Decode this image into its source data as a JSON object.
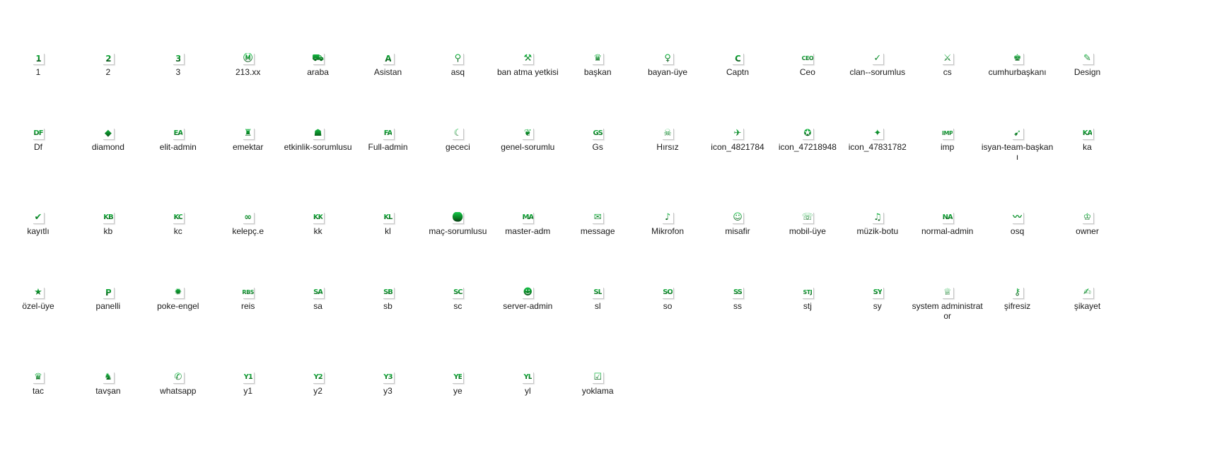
{
  "folder": {
    "items": [
      {
        "label": "1",
        "icon": "digit-one-icon",
        "glyph": "1"
      },
      {
        "label": "2",
        "icon": "digit-two-icon",
        "glyph": "2"
      },
      {
        "label": "3",
        "icon": "digit-three-icon",
        "glyph": "3"
      },
      {
        "label": "213.xx",
        "icon": "monogram-emblem-icon",
        "glyph": "Ⓜ"
      },
      {
        "label": "araba",
        "icon": "car-icon",
        "glyph": "⛟"
      },
      {
        "label": "Asistan",
        "icon": "letter-a-icon",
        "glyph": "A"
      },
      {
        "label": "asq",
        "icon": "user-search-icon",
        "glyph": "⚲"
      },
      {
        "label": "ban atma yetkisi",
        "icon": "ban-hammer-icon",
        "glyph": "⚒"
      },
      {
        "label": "başkan",
        "icon": "crown-icon",
        "glyph": "♛"
      },
      {
        "label": "bayan-üye",
        "icon": "female-user-icon",
        "glyph": "♀"
      },
      {
        "label": "Captn",
        "icon": "letter-c-icon",
        "glyph": "C"
      },
      {
        "label": "Ceo",
        "icon": "ceo-text-icon",
        "glyph": "CEO"
      },
      {
        "label": "clan--sorumlus",
        "icon": "shield-check-icon",
        "glyph": "✓"
      },
      {
        "label": "cs",
        "icon": "running-figure-icon",
        "glyph": "⚔"
      },
      {
        "label": "cumhurbaşkanı",
        "icon": "leader-bust-icon",
        "glyph": "♚"
      },
      {
        "label": "Design",
        "icon": "design-brush-icon",
        "glyph": "✎"
      },
      {
        "label": "Df",
        "icon": "df-text-icon",
        "glyph": "DF"
      },
      {
        "label": "diamond",
        "icon": "diamond-icon",
        "glyph": "◆"
      },
      {
        "label": "elit-admin",
        "icon": "ea-text-icon",
        "glyph": "EA"
      },
      {
        "label": "emektar",
        "icon": "veteran-figure-icon",
        "glyph": "♜"
      },
      {
        "label": "etkinlik-sorumlusu",
        "icon": "event-figure-icon",
        "glyph": "☗"
      },
      {
        "label": "Full-admin",
        "icon": "fa-text-icon",
        "glyph": "FA"
      },
      {
        "label": "gececi",
        "icon": "crescent-moon-icon",
        "glyph": "☾"
      },
      {
        "label": "genel-sorumlu",
        "icon": "winged-emblem-icon",
        "glyph": "❦"
      },
      {
        "label": "Gs",
        "icon": "gs-text-icon",
        "glyph": "GS"
      },
      {
        "label": "Hırsız",
        "icon": "thief-figure-icon",
        "glyph": "☠"
      },
      {
        "label": "icon_4821784",
        "icon": "bird-icon",
        "glyph": "✈"
      },
      {
        "label": "icon_47218948",
        "icon": "insignia-icon",
        "glyph": "✪"
      },
      {
        "label": "icon_47831782",
        "icon": "eagle-icon",
        "glyph": "✦"
      },
      {
        "label": "imp",
        "icon": "imp-text-icon",
        "glyph": "IMP"
      },
      {
        "label": "isyan-team-başkanı",
        "icon": "rifle-figure-icon",
        "glyph": "➹"
      },
      {
        "label": "ka",
        "icon": "ka-text-icon",
        "glyph": "KA"
      },
      {
        "label": "kayıtlı",
        "icon": "check-mark-icon",
        "glyph": "✔"
      },
      {
        "label": "kb",
        "icon": "kb-text-icon",
        "glyph": "KB"
      },
      {
        "label": "kc",
        "icon": "kc-text-icon",
        "glyph": "KC"
      },
      {
        "label": "kelepç.e",
        "icon": "handcuffs-icon",
        "glyph": "∞"
      },
      {
        "label": "kk",
        "icon": "kk-text-icon",
        "glyph": "KK"
      },
      {
        "label": "kl",
        "icon": "kl-text-icon",
        "glyph": "KL"
      },
      {
        "label": "maç-sorumlusu",
        "icon": "football-icon",
        "glyph": "⚽"
      },
      {
        "label": "master-adm",
        "icon": "ma-text-icon",
        "glyph": "MA"
      },
      {
        "label": "message",
        "icon": "message-envelope-icon",
        "glyph": "✉"
      },
      {
        "label": "Mikrofon",
        "icon": "microphone-icon",
        "glyph": "♪"
      },
      {
        "label": "misafir",
        "icon": "guest-user-icon",
        "glyph": "☺"
      },
      {
        "label": "mobil-üye",
        "icon": "mobile-phone-icon",
        "glyph": "☏"
      },
      {
        "label": "müzik-botu",
        "icon": "music-note-icon",
        "glyph": "♫"
      },
      {
        "label": "normal-admin",
        "icon": "na-text-icon",
        "glyph": "NA"
      },
      {
        "label": "osq",
        "icon": "swoosh-icon",
        "glyph": "〰"
      },
      {
        "label": "owner",
        "icon": "owner-figure-icon",
        "glyph": "♔"
      },
      {
        "label": "özel-üye",
        "icon": "star-icon",
        "glyph": "★"
      },
      {
        "label": "panelli",
        "icon": "letter-p-icon",
        "glyph": "P"
      },
      {
        "label": "poke-engel",
        "icon": "burst-icon",
        "glyph": "✹"
      },
      {
        "label": "reis",
        "icon": "reis-text-icon",
        "glyph": "RBS"
      },
      {
        "label": "sa",
        "icon": "sa-text-icon",
        "glyph": "SA"
      },
      {
        "label": "sb",
        "icon": "sb-text-icon",
        "glyph": "SB"
      },
      {
        "label": "sc",
        "icon": "sc-text-icon",
        "glyph": "SC"
      },
      {
        "label": "server-admin",
        "icon": "server-admin-user-icon",
        "glyph": "☻"
      },
      {
        "label": "sl",
        "icon": "sl-text-icon",
        "glyph": "SL"
      },
      {
        "label": "so",
        "icon": "so-text-icon",
        "glyph": "SO"
      },
      {
        "label": "ss",
        "icon": "ss-text-icon",
        "glyph": "SS"
      },
      {
        "label": "stj",
        "icon": "stj-text-icon",
        "glyph": "STJ"
      },
      {
        "label": "sy",
        "icon": "sy-text-icon",
        "glyph": "SY"
      },
      {
        "label": "system administrator",
        "icon": "sysadmin-crown-icon",
        "glyph": "♕"
      },
      {
        "label": "şifresiz",
        "icon": "key-icon",
        "glyph": "⚷"
      },
      {
        "label": "şikayet",
        "icon": "complaint-form-icon",
        "glyph": "✍"
      },
      {
        "label": "tac",
        "icon": "tiara-crown-icon",
        "glyph": "♛"
      },
      {
        "label": "tavşan",
        "icon": "rabbit-icon",
        "glyph": "♞"
      },
      {
        "label": "whatsapp",
        "icon": "whatsapp-icon",
        "glyph": "✆"
      },
      {
        "label": "y1",
        "icon": "y1-text-icon",
        "glyph": "Y1"
      },
      {
        "label": "y2",
        "icon": "y2-text-icon",
        "glyph": "Y2"
      },
      {
        "label": "y3",
        "icon": "y3-text-icon",
        "glyph": "Y3"
      },
      {
        "label": "ye",
        "icon": "ye-text-icon",
        "glyph": "YE"
      },
      {
        "label": "yl",
        "icon": "yl-text-icon",
        "glyph": "YL"
      },
      {
        "label": "yoklama",
        "icon": "attendance-clipboard-icon",
        "glyph": "☑"
      }
    ]
  },
  "colors": {
    "icon_green": "#16c84a",
    "icon_dark": "#0b1f10",
    "label_text": "#1a1a1a",
    "background": "#ffffff"
  }
}
